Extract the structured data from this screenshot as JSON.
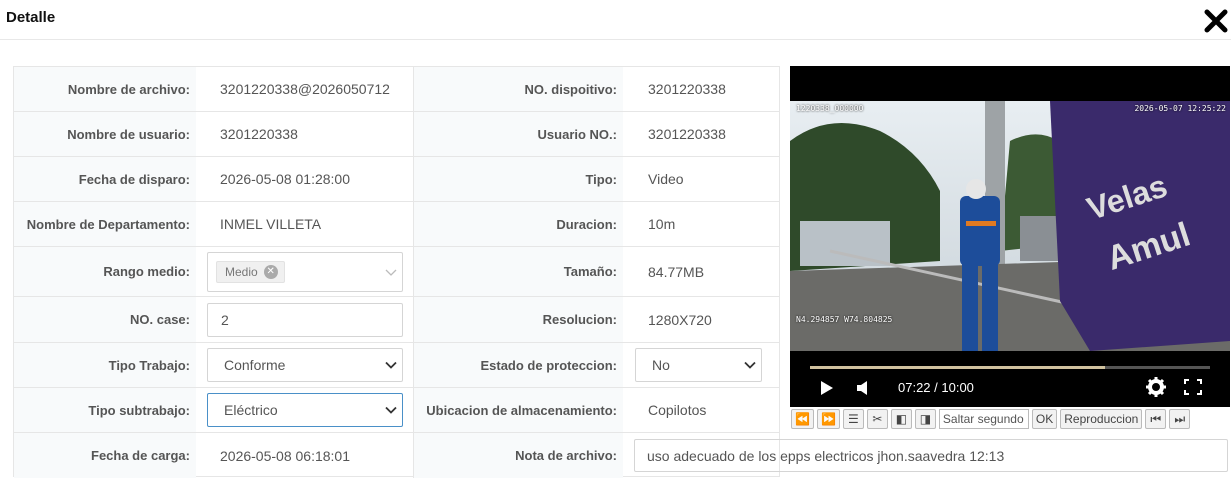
{
  "header": {
    "title": "Detalle"
  },
  "fields": {
    "nombre_archivo": {
      "label": "Nombre de archivo:",
      "value": "3201220338@2026050712"
    },
    "no_dispositivo": {
      "label": "NO. dispoitivo:",
      "value": "3201220338"
    },
    "nombre_usuario": {
      "label": "Nombre de usuario:",
      "value": "3201220338"
    },
    "usuario_no": {
      "label": "Usuario NO.:",
      "value": "3201220338"
    },
    "fecha_disparo": {
      "label": "Fecha de disparo:",
      "value": "2026-05-08 01:28:00"
    },
    "tipo": {
      "label": "Tipo:",
      "value": "Video"
    },
    "departamento": {
      "label": "Nombre de Departamento:",
      "value": "INMEL VILLETA"
    },
    "duracion": {
      "label": "Duracion:",
      "value": "10m"
    },
    "rango_medio": {
      "label": "Rango medio:",
      "tag": "Medio"
    },
    "tamano": {
      "label": "Tamaño:",
      "value": "84.77MB"
    },
    "no_case": {
      "label": "NO. case:",
      "value": "2"
    },
    "resolucion": {
      "label": "Resolucion:",
      "value": "1280X720"
    },
    "tipo_trabajo": {
      "label": "Tipo Trabajo:",
      "value": "Conforme"
    },
    "estado_proteccion": {
      "label": "Estado de proteccion:",
      "value": "No"
    },
    "tipo_subtrabajo": {
      "label": "Tipo subtrabajo:",
      "value": "Eléctrico"
    },
    "ubicacion": {
      "label": "Ubicacion de almacenamiento:",
      "value": "Copilotos"
    },
    "fecha_carga": {
      "label": "Fecha de carga:",
      "value": "2026-05-08 06:18:01"
    },
    "nota": {
      "label": "Nota de archivo:",
      "value": "uso adecuado de los epps electricos jhon.saavedra 12:13"
    }
  },
  "player": {
    "osd_device": "1220338_000000",
    "osd_datetime": "2026-05-07 12:25:22",
    "osd_gps": "N4.294857 W74.804825",
    "time_display": "07:22 / 10:00",
    "progress_fraction": 0.737
  },
  "toolbar": {
    "seek_placeholder": "Saltar segundo",
    "ok_label": "OK",
    "playback_label": "Reproduccion"
  }
}
